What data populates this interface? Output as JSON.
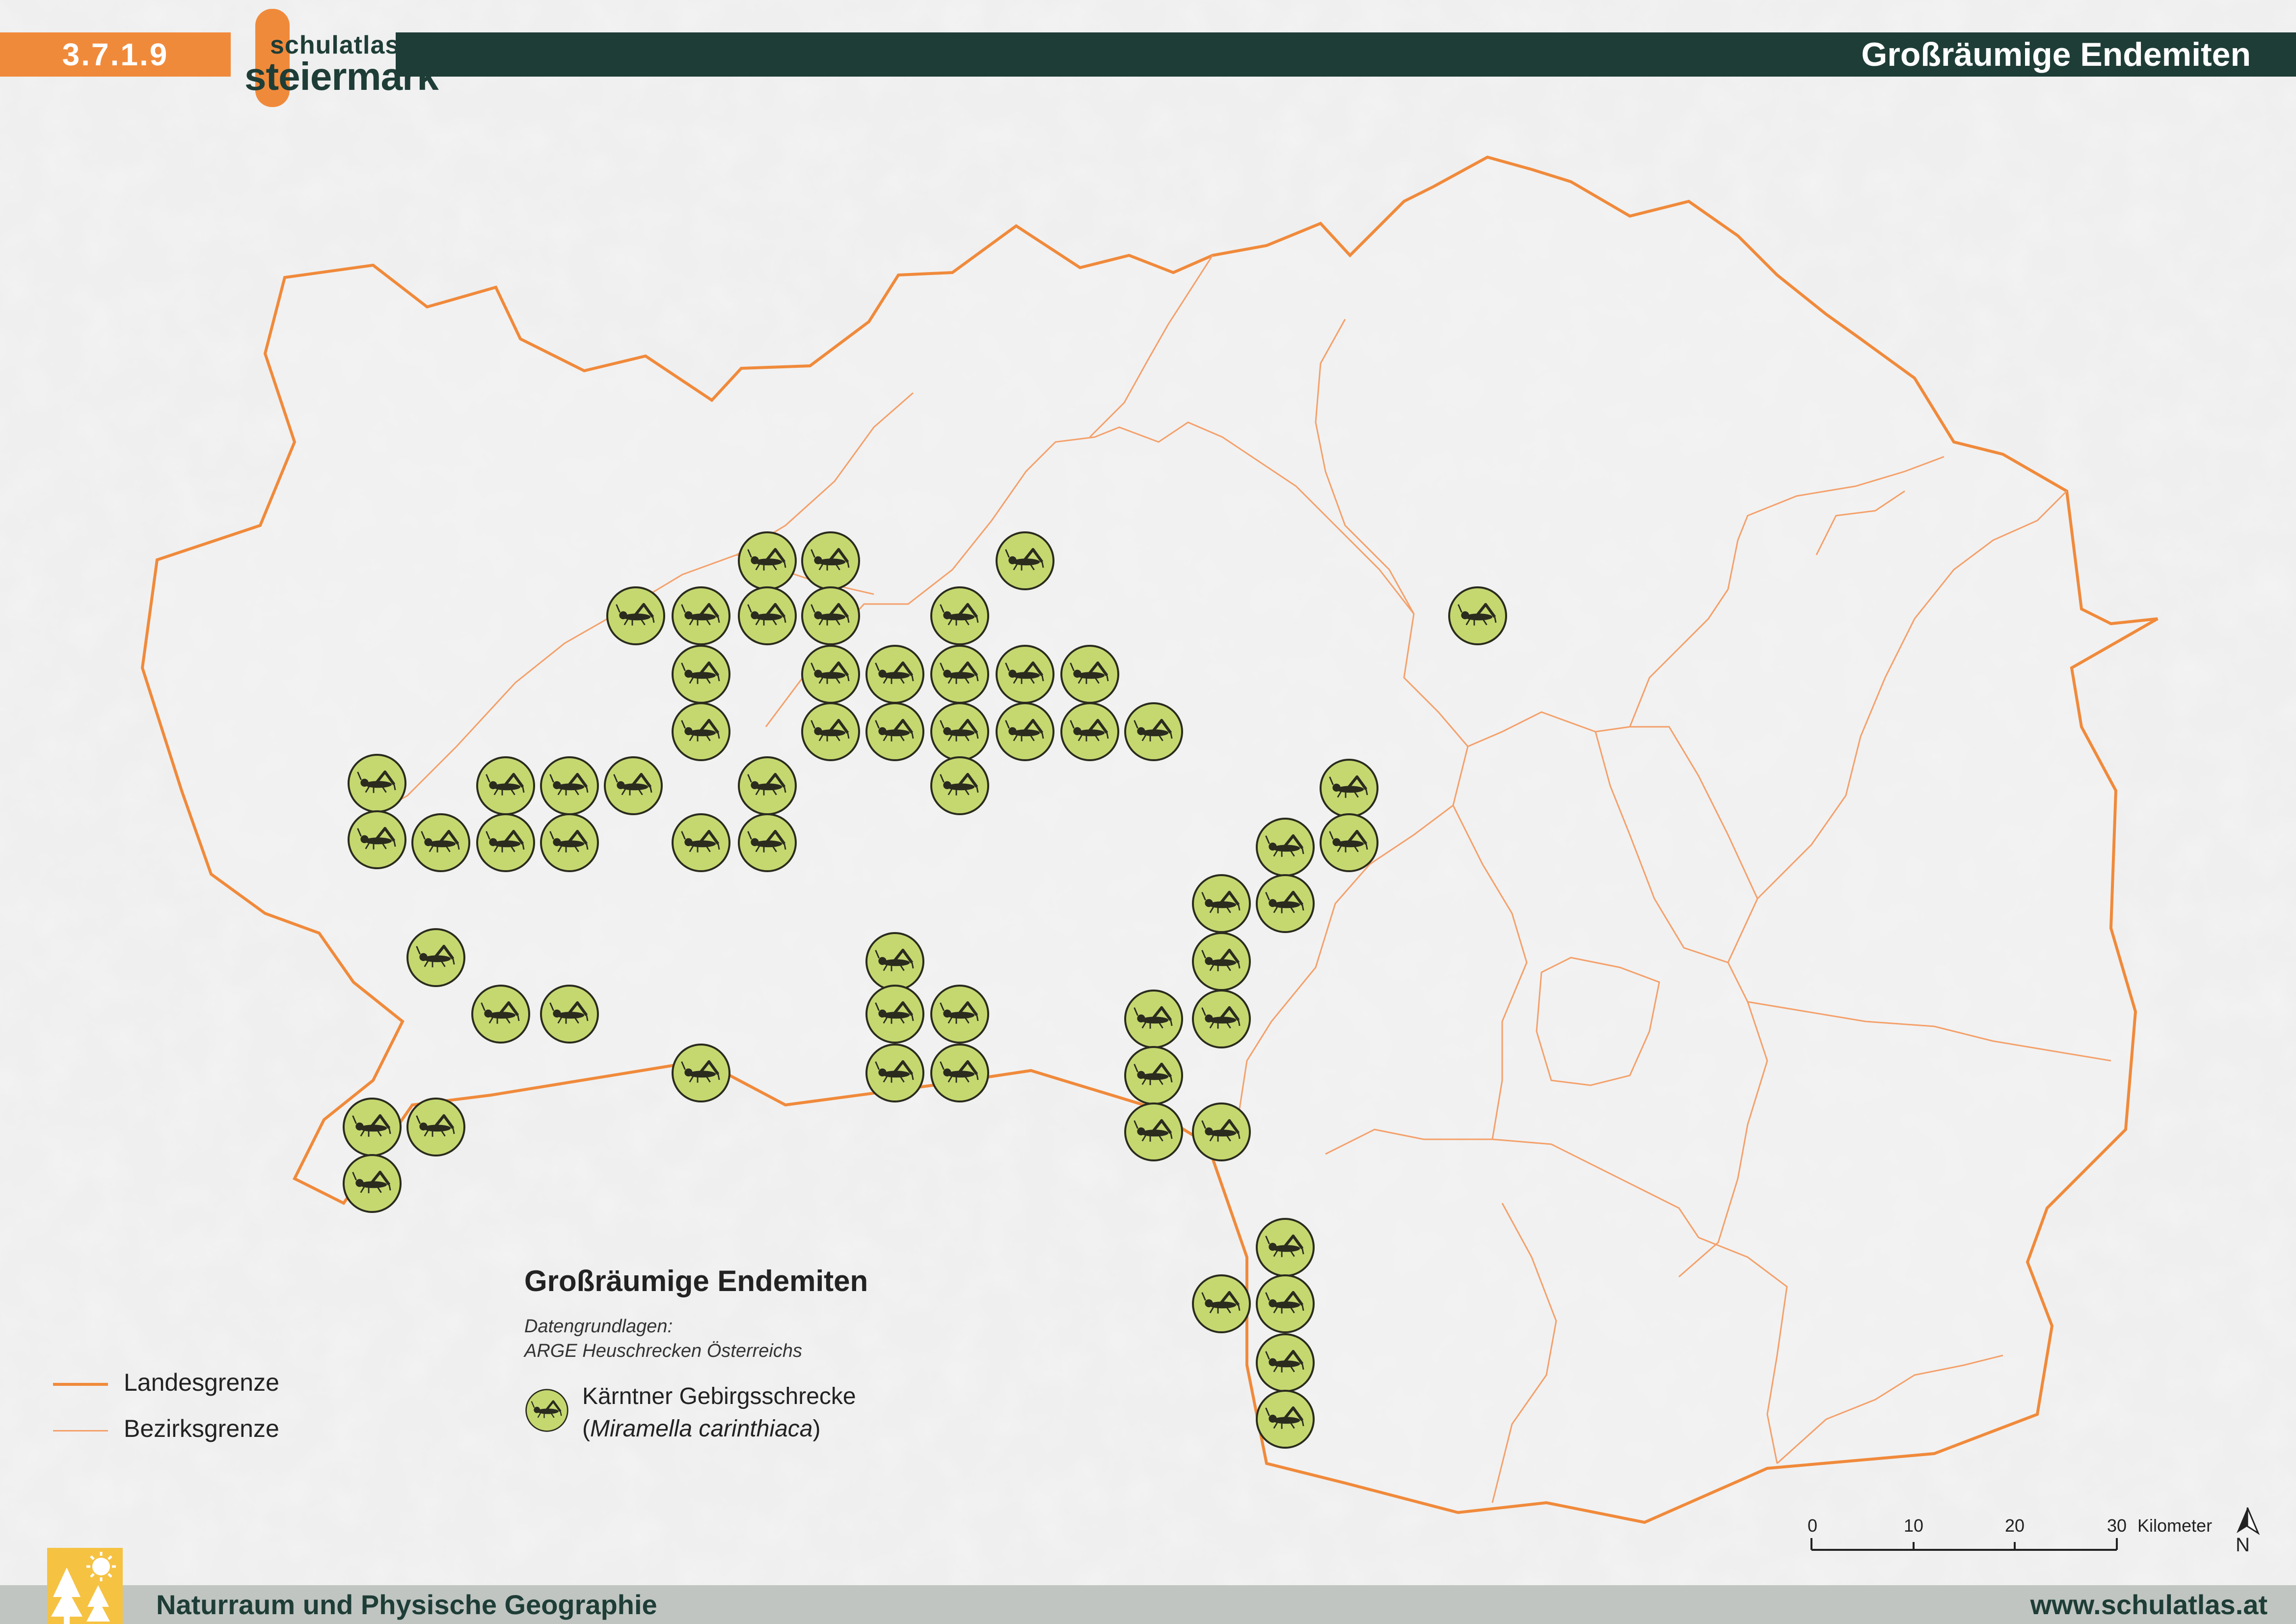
{
  "header": {
    "number": "3.7.1.9",
    "logo_top": "schulatlas",
    "logo_main": "steiermark",
    "title": "Großräumige Endemiten"
  },
  "footer": {
    "left": "Naturraum und Physische Geographie",
    "right": "www.schulatlas.at"
  },
  "legend": {
    "title": "Großräumige Endemiten",
    "source_line1": "Datengrundlagen:",
    "source_line2": "ARGE Heuschrecken Österreichs",
    "species_common": "Kärntner Gebirgsschrecke",
    "species_open": "(",
    "species_latin": "Miramella carinthiaca",
    "species_close": ")",
    "boundary_state": "Landesgrenze",
    "boundary_district": "Bezirksgrenze"
  },
  "scale": {
    "ticks": [
      "0",
      "10",
      "20",
      "30"
    ],
    "unit": "Kilometer",
    "north": "N"
  },
  "colors": {
    "accent_orange": "#f08a3b",
    "dark_green": "#1e3d36",
    "symbol_fill": "#c5d870",
    "boundary": "#f08a3b"
  },
  "icons": {
    "symbol": "grasshopper-icon",
    "north": "north-arrow-icon",
    "footer": "nature-icon"
  }
}
